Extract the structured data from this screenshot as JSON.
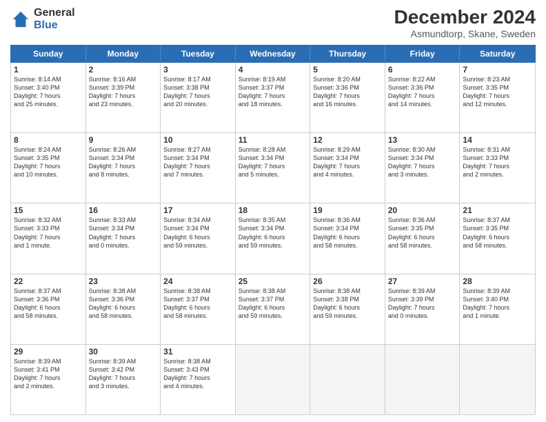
{
  "header": {
    "logo_general": "General",
    "logo_blue": "Blue",
    "title": "December 2024",
    "subtitle": "Asmundtorp, Skane, Sweden"
  },
  "days": [
    "Sunday",
    "Monday",
    "Tuesday",
    "Wednesday",
    "Thursday",
    "Friday",
    "Saturday"
  ],
  "weeks": [
    [
      {
        "day": "1",
        "lines": [
          "Sunrise: 8:14 AM",
          "Sunset: 3:40 PM",
          "Daylight: 7 hours",
          "and 25 minutes."
        ]
      },
      {
        "day": "2",
        "lines": [
          "Sunrise: 8:16 AM",
          "Sunset: 3:39 PM",
          "Daylight: 7 hours",
          "and 23 minutes."
        ]
      },
      {
        "day": "3",
        "lines": [
          "Sunrise: 8:17 AM",
          "Sunset: 3:38 PM",
          "Daylight: 7 hours",
          "and 20 minutes."
        ]
      },
      {
        "day": "4",
        "lines": [
          "Sunrise: 8:19 AM",
          "Sunset: 3:37 PM",
          "Daylight: 7 hours",
          "and 18 minutes."
        ]
      },
      {
        "day": "5",
        "lines": [
          "Sunrise: 8:20 AM",
          "Sunset: 3:36 PM",
          "Daylight: 7 hours",
          "and 16 minutes."
        ]
      },
      {
        "day": "6",
        "lines": [
          "Sunrise: 8:22 AM",
          "Sunset: 3:36 PM",
          "Daylight: 7 hours",
          "and 14 minutes."
        ]
      },
      {
        "day": "7",
        "lines": [
          "Sunrise: 8:23 AM",
          "Sunset: 3:35 PM",
          "Daylight: 7 hours",
          "and 12 minutes."
        ]
      }
    ],
    [
      {
        "day": "8",
        "lines": [
          "Sunrise: 8:24 AM",
          "Sunset: 3:35 PM",
          "Daylight: 7 hours",
          "and 10 minutes."
        ]
      },
      {
        "day": "9",
        "lines": [
          "Sunrise: 8:26 AM",
          "Sunset: 3:34 PM",
          "Daylight: 7 hours",
          "and 8 minutes."
        ]
      },
      {
        "day": "10",
        "lines": [
          "Sunrise: 8:27 AM",
          "Sunset: 3:34 PM",
          "Daylight: 7 hours",
          "and 7 minutes."
        ]
      },
      {
        "day": "11",
        "lines": [
          "Sunrise: 8:28 AM",
          "Sunset: 3:34 PM",
          "Daylight: 7 hours",
          "and 5 minutes."
        ]
      },
      {
        "day": "12",
        "lines": [
          "Sunrise: 8:29 AM",
          "Sunset: 3:34 PM",
          "Daylight: 7 hours",
          "and 4 minutes."
        ]
      },
      {
        "day": "13",
        "lines": [
          "Sunrise: 8:30 AM",
          "Sunset: 3:34 PM",
          "Daylight: 7 hours",
          "and 3 minutes."
        ]
      },
      {
        "day": "14",
        "lines": [
          "Sunrise: 8:31 AM",
          "Sunset: 3:33 PM",
          "Daylight: 7 hours",
          "and 2 minutes."
        ]
      }
    ],
    [
      {
        "day": "15",
        "lines": [
          "Sunrise: 8:32 AM",
          "Sunset: 3:33 PM",
          "Daylight: 7 hours",
          "and 1 minute."
        ]
      },
      {
        "day": "16",
        "lines": [
          "Sunrise: 8:33 AM",
          "Sunset: 3:34 PM",
          "Daylight: 7 hours",
          "and 0 minutes."
        ]
      },
      {
        "day": "17",
        "lines": [
          "Sunrise: 8:34 AM",
          "Sunset: 3:34 PM",
          "Daylight: 6 hours",
          "and 59 minutes."
        ]
      },
      {
        "day": "18",
        "lines": [
          "Sunrise: 8:35 AM",
          "Sunset: 3:34 PM",
          "Daylight: 6 hours",
          "and 59 minutes."
        ]
      },
      {
        "day": "19",
        "lines": [
          "Sunrise: 8:36 AM",
          "Sunset: 3:34 PM",
          "Daylight: 6 hours",
          "and 58 minutes."
        ]
      },
      {
        "day": "20",
        "lines": [
          "Sunrise: 8:36 AM",
          "Sunset: 3:35 PM",
          "Daylight: 6 hours",
          "and 58 minutes."
        ]
      },
      {
        "day": "21",
        "lines": [
          "Sunrise: 8:37 AM",
          "Sunset: 3:35 PM",
          "Daylight: 6 hours",
          "and 58 minutes."
        ]
      }
    ],
    [
      {
        "day": "22",
        "lines": [
          "Sunrise: 8:37 AM",
          "Sunset: 3:36 PM",
          "Daylight: 6 hours",
          "and 58 minutes."
        ]
      },
      {
        "day": "23",
        "lines": [
          "Sunrise: 8:38 AM",
          "Sunset: 3:36 PM",
          "Daylight: 6 hours",
          "and 58 minutes."
        ]
      },
      {
        "day": "24",
        "lines": [
          "Sunrise: 8:38 AM",
          "Sunset: 3:37 PM",
          "Daylight: 6 hours",
          "and 58 minutes."
        ]
      },
      {
        "day": "25",
        "lines": [
          "Sunrise: 8:38 AM",
          "Sunset: 3:37 PM",
          "Daylight: 6 hours",
          "and 59 minutes."
        ]
      },
      {
        "day": "26",
        "lines": [
          "Sunrise: 8:38 AM",
          "Sunset: 3:38 PM",
          "Daylight: 6 hours",
          "and 59 minutes."
        ]
      },
      {
        "day": "27",
        "lines": [
          "Sunrise: 8:39 AM",
          "Sunset: 3:39 PM",
          "Daylight: 7 hours",
          "and 0 minutes."
        ]
      },
      {
        "day": "28",
        "lines": [
          "Sunrise: 8:39 AM",
          "Sunset: 3:40 PM",
          "Daylight: 7 hours",
          "and 1 minute."
        ]
      }
    ],
    [
      {
        "day": "29",
        "lines": [
          "Sunrise: 8:39 AM",
          "Sunset: 3:41 PM",
          "Daylight: 7 hours",
          "and 2 minutes."
        ]
      },
      {
        "day": "30",
        "lines": [
          "Sunrise: 8:39 AM",
          "Sunset: 3:42 PM",
          "Daylight: 7 hours",
          "and 3 minutes."
        ]
      },
      {
        "day": "31",
        "lines": [
          "Sunrise: 8:38 AM",
          "Sunset: 3:43 PM",
          "Daylight: 7 hours",
          "and 4 minutes."
        ]
      },
      null,
      null,
      null,
      null
    ]
  ]
}
